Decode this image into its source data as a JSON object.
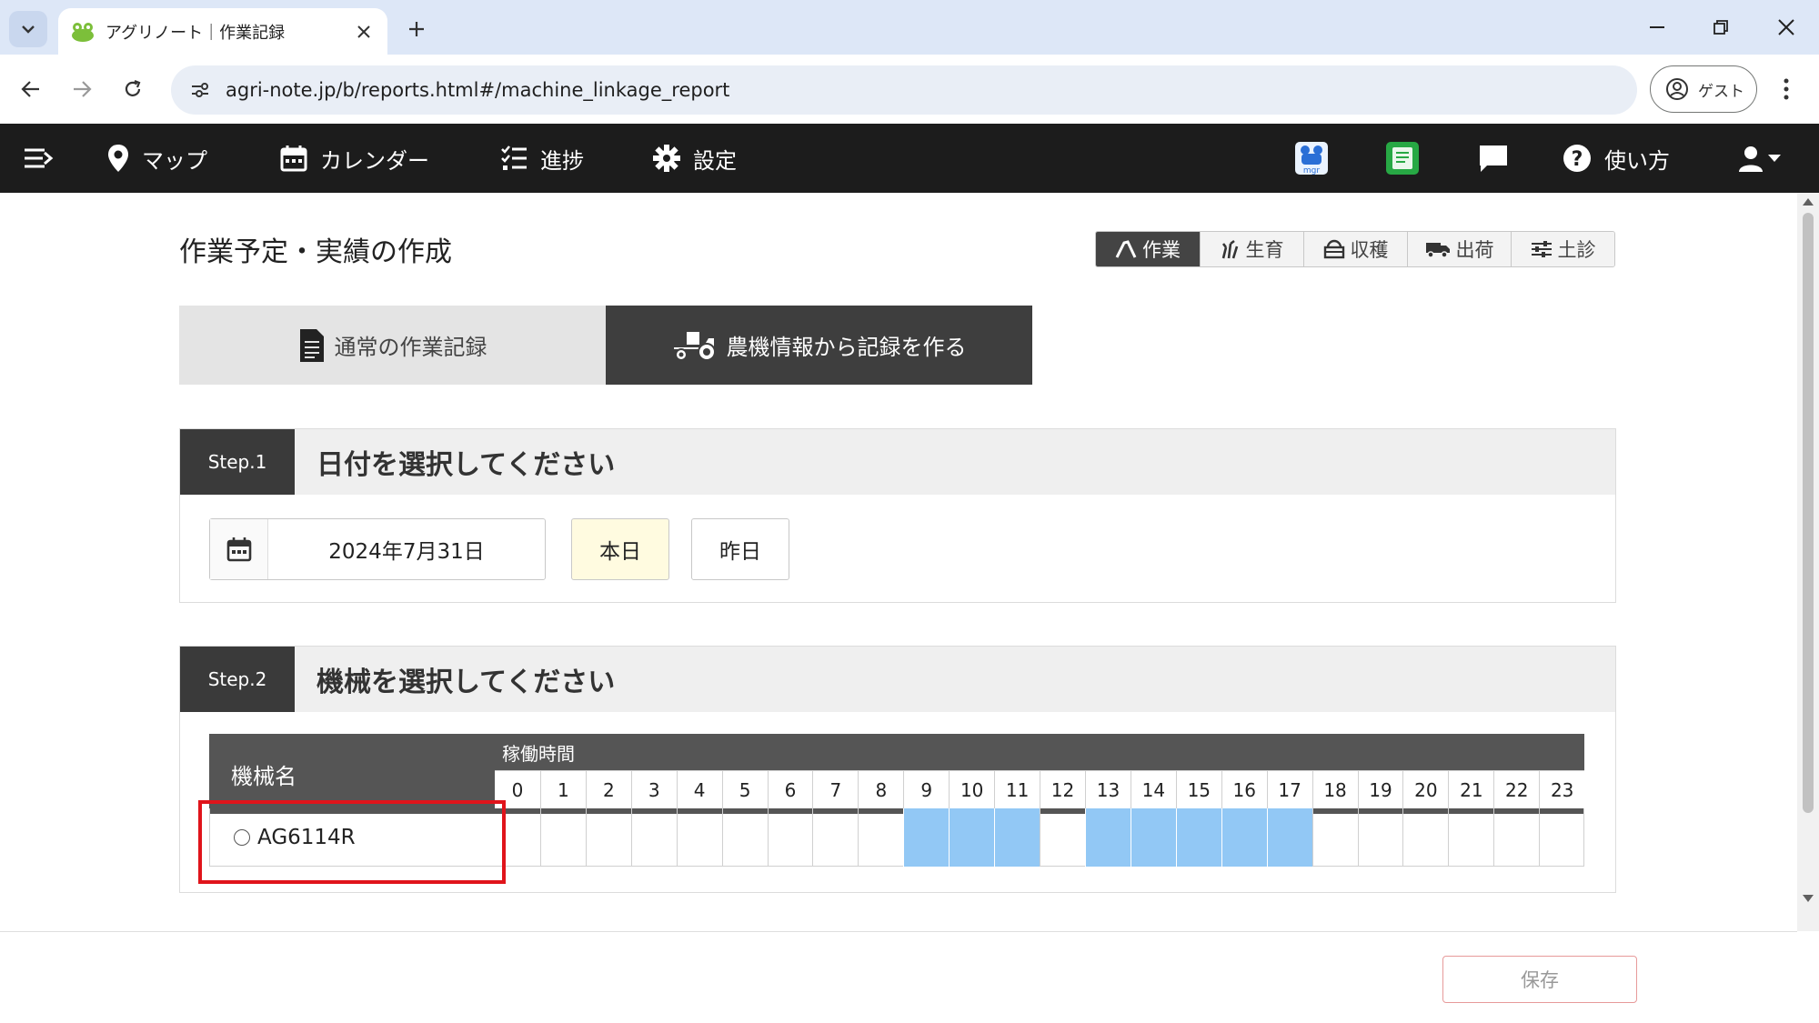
{
  "browser": {
    "tab_title": "アグリノート｜作業記録",
    "url": "agri-note.jp/b/reports.html#/machine_linkage_report",
    "profile_label": "ゲスト"
  },
  "appnav": {
    "items": [
      {
        "label": "マップ",
        "icon": "map-pin-icon"
      },
      {
        "label": "カレンダー",
        "icon": "calendar-icon"
      },
      {
        "label": "進捗",
        "icon": "list-icon"
      },
      {
        "label": "設定",
        "icon": "gear-icon"
      }
    ],
    "help_label": "使い方"
  },
  "page": {
    "title": "作業予定・実績の作成",
    "segments": [
      {
        "label": "作業",
        "active": true
      },
      {
        "label": "生育",
        "active": false
      },
      {
        "label": "収穫",
        "active": false
      },
      {
        "label": "出荷",
        "active": false
      },
      {
        "label": "土診",
        "active": false
      }
    ],
    "mode_tabs": [
      {
        "label": "通常の作業記録",
        "active": false
      },
      {
        "label": "農機情報から記録を作る",
        "active": true
      }
    ]
  },
  "step1": {
    "badge": "Step.1",
    "title": "日付を選択してください",
    "date_value": "2024年7月31日",
    "today_label": "本日",
    "yesterday_label": "昨日"
  },
  "step2": {
    "badge": "Step.2",
    "title": "機械を選択してください",
    "col_name": "機械名",
    "col_time": "稼働時間",
    "hours": [
      "0",
      "1",
      "2",
      "3",
      "4",
      "5",
      "6",
      "7",
      "8",
      "9",
      "10",
      "11",
      "12",
      "13",
      "14",
      "15",
      "16",
      "17",
      "18",
      "19",
      "20",
      "21",
      "22",
      "23"
    ],
    "machines": [
      {
        "name": "AG6114R",
        "active_hours": [
          9,
          10,
          11,
          13,
          14,
          15,
          16,
          17
        ]
      }
    ]
  },
  "footer": {
    "save_label": "保存"
  },
  "colors": {
    "active_hour": "#92c8f5",
    "highlight": "#e0141b",
    "nav_bg": "#1c1c1c"
  }
}
